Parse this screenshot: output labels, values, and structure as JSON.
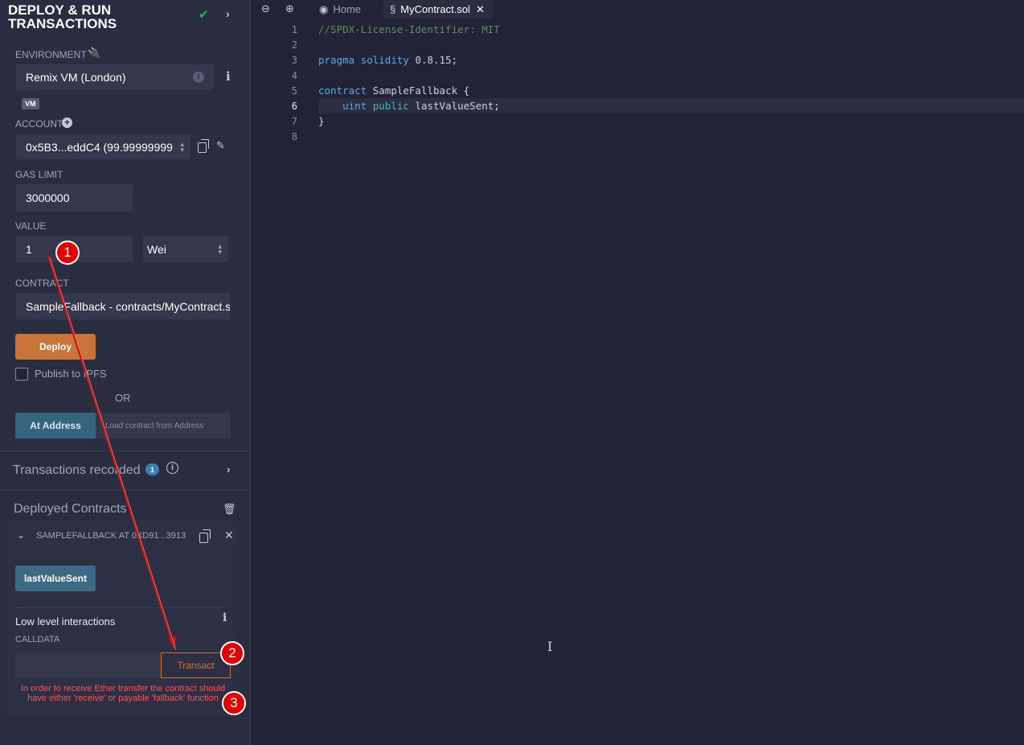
{
  "panel": {
    "title": "DEPLOY & RUN TRANSACTIONS",
    "environment_label": "ENVIRONMENT",
    "environment_value": "Remix VM (London)",
    "vm_badge": "VM",
    "account_label": "ACCOUNT",
    "account_value": "0x5B3...eddC4 (99.99999999",
    "gas_limit_label": "GAS LIMIT",
    "gas_limit_value": "3000000",
    "value_label": "VALUE",
    "value_value": "1",
    "value_unit": "Wei",
    "contract_label": "CONTRACT",
    "contract_value": "SampleFallback - contracts/MyContract.sol",
    "deploy_button": "Deploy",
    "publish_label": "Publish to IPFS",
    "or_text": "OR",
    "at_address_button": "At Address",
    "at_address_placeholder": "Load contract from Address",
    "transactions_recorded": "Transactions recorded",
    "transactions_count": "1",
    "deployed_title": "Deployed Contracts",
    "deployed_instance": "SAMPLEFALLBACK AT 0XD91...3913",
    "last_value_sent_button": "lastValueSent",
    "low_level_title": "Low level interactions",
    "calldata_label": "CALLDATA",
    "transact_button": "Transact",
    "error_message": "In order to receive Ether transfer the contract should have either 'receive' or payable 'fallback' function"
  },
  "markers": [
    "1",
    "2",
    "3"
  ],
  "tabs": [
    {
      "label": "Home"
    },
    {
      "label": "MyContract.sol"
    }
  ],
  "editor": {
    "line_numbers": [
      "1",
      "2",
      "3",
      "4",
      "5",
      "6",
      "7",
      "8"
    ],
    "lines": [
      {
        "text": "//SPDX-License-Identifier: MIT",
        "kind": "comment"
      },
      {
        "text": "",
        "kind": "plain"
      },
      {
        "text": "pragma solidity 0.8.15;",
        "kind": "pragma"
      },
      {
        "text": "",
        "kind": "plain"
      },
      {
        "text": "contract SampleFallback {",
        "kind": "contract"
      },
      {
        "text": "    uint public lastValueSent;",
        "kind": "field"
      },
      {
        "text": "}",
        "kind": "plain"
      },
      {
        "text": "",
        "kind": "plain"
      }
    ]
  },
  "colors": {
    "accent_orange": "#c97539",
    "error_red": "#ff5050",
    "marker_red": "#e10000",
    "keyword_blue": "#5aa9e6",
    "comment_green": "#5c8d5b"
  }
}
